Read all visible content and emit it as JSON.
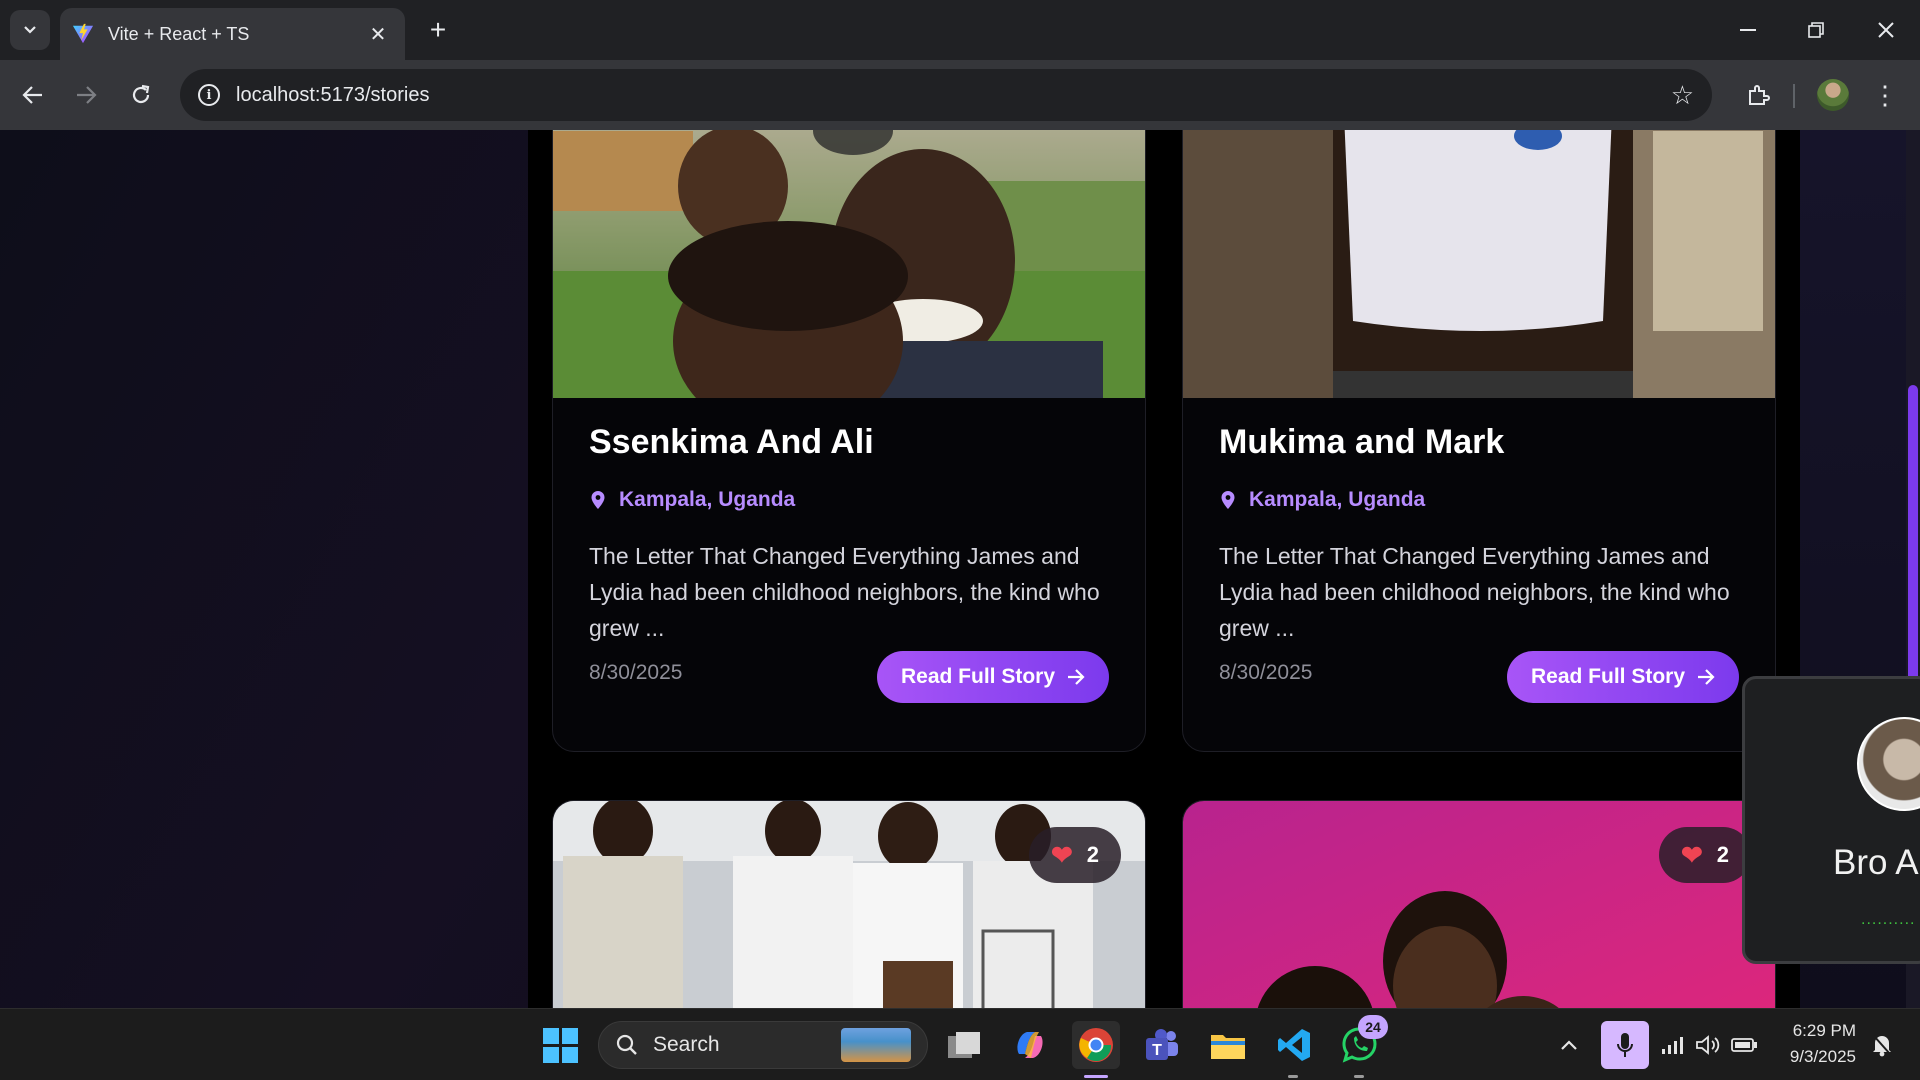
{
  "browser": {
    "tab_title": "Vite + React + TS",
    "url": "localhost:5173/stories"
  },
  "stories": [
    {
      "title": "Ssenkima And Ali",
      "location": "Kampala, Uganda",
      "excerpt": "The Letter That Changed Everything James and Lydia had been childhood neighbors, the kind who grew ...",
      "date": "8/30/2025",
      "button_label": "Read Full Story"
    },
    {
      "title": "Mukima and Mark",
      "location": "Kampala, Uganda",
      "excerpt": "The Letter That Changed Everything James and Lydia had been childhood neighbors, the kind who grew ...",
      "date": "8/30/2025",
      "button_label": "Read Full Story"
    },
    {
      "likes": "2"
    },
    {
      "likes": "2"
    }
  ],
  "call_widget": {
    "name": "Bro A",
    "status_dots": "..........",
    "status_color": "#3fc33f"
  },
  "taskbar": {
    "search_placeholder": "Search",
    "whatsapp_badge": "24",
    "time": "6:29 PM",
    "date": "9/3/2025"
  },
  "colors": {
    "accent": "#a855f7",
    "accent_dark": "#7c3aed",
    "location_text": "#b78cff",
    "heart": "#ef4453"
  },
  "icons": [
    "vite-favicon",
    "back-icon",
    "forward-icon",
    "reload-icon",
    "info-icon",
    "star-icon",
    "extensions-icon",
    "menu-icon",
    "pin-icon",
    "arrow-right-icon",
    "heart-icon",
    "search-icon",
    "microphone-icon"
  ]
}
